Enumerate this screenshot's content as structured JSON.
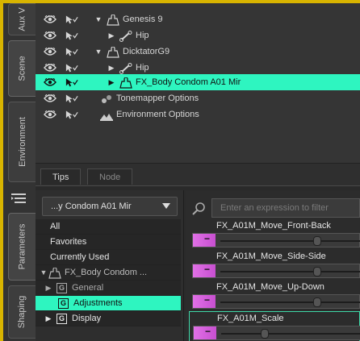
{
  "side_tabs_top": [
    {
      "label": "Aux V"
    },
    {
      "label": "Scene"
    },
    {
      "label": "Environment"
    }
  ],
  "side_tabs_bottom": [
    {
      "label": "Parameters"
    },
    {
      "label": "Shaping"
    }
  ],
  "scene": {
    "rows": [
      {
        "label": "Genesis 9",
        "expand": "▼",
        "icon": "figure-icon"
      },
      {
        "label": "Hip",
        "expand": "▶",
        "icon": "bone-icon"
      },
      {
        "label": "DicktatorG9",
        "expand": "▼",
        "icon": "figure-icon"
      },
      {
        "label": "Hip",
        "expand": "▶",
        "icon": "bone-icon"
      },
      {
        "label": "FX_Body Condom A01 Mir",
        "expand": "▶",
        "icon": "figure-icon",
        "selected": true
      },
      {
        "label": "Tonemapper Options",
        "expand": "",
        "icon": "camera-icon"
      },
      {
        "label": "Environment Options",
        "expand": "",
        "icon": "landscape-icon"
      }
    ]
  },
  "bottom_tabs": {
    "tips": "Tips",
    "node": "Node"
  },
  "params": {
    "node_dropdown": "...y Condom A01 Mir",
    "search_placeholder": "Enter an expression to filter",
    "list": [
      {
        "label": "All"
      },
      {
        "label": "Favorites"
      },
      {
        "label": "Currently Used"
      },
      {
        "label": "FX_Body Condom ..."
      },
      {
        "label": "General",
        "group": "G"
      },
      {
        "label": "Adjustments",
        "group": "G",
        "selected": true
      },
      {
        "label": "Display",
        "group": "G"
      }
    ],
    "sliders": [
      {
        "name": "FX_A01M_Move_Front-Back",
        "value": 0.7
      },
      {
        "name": "FX_A01M_Move_Side-Side",
        "value": 0.7
      },
      {
        "name": "FX_A01M_Move_Up-Down",
        "value": 0.7
      },
      {
        "name": "FX_A01M_Scale",
        "value": 0.3,
        "selected": true
      }
    ]
  },
  "colors": {
    "selection": "#2ef5c0",
    "slider_fill": "#d45ddc",
    "frame_border": "#d8b400"
  }
}
